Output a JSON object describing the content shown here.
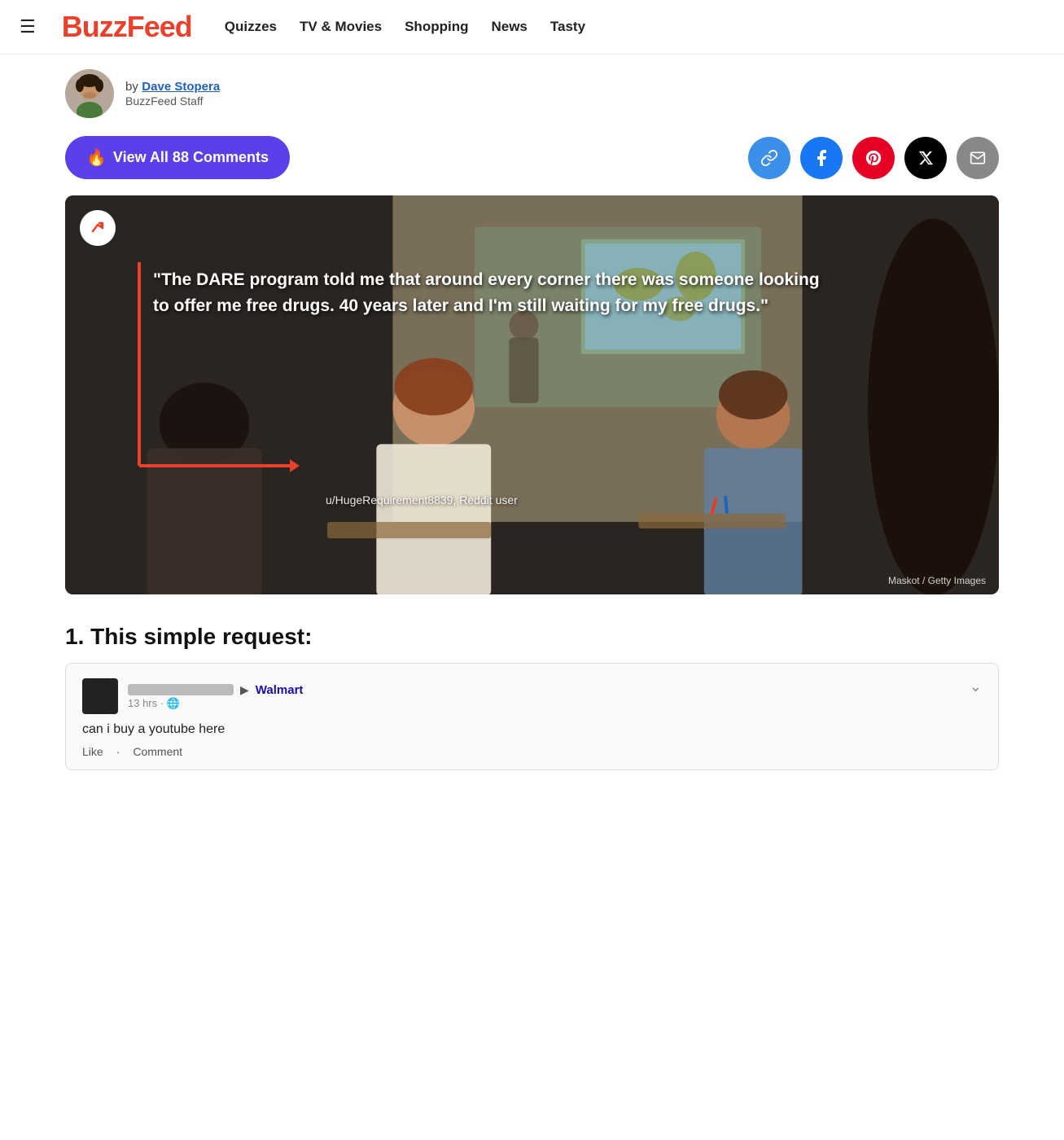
{
  "nav": {
    "hamburger_label": "☰",
    "logo": "BuzzFeed",
    "links": [
      {
        "id": "quizzes",
        "label": "Quizzes"
      },
      {
        "id": "tv-movies",
        "label": "TV & Movies"
      },
      {
        "id": "shopping",
        "label": "Shopping"
      },
      {
        "id": "news",
        "label": "News"
      },
      {
        "id": "tasty",
        "label": "Tasty"
      }
    ]
  },
  "author": {
    "by_label": "by",
    "name": "Dave Stopera",
    "staff_label": "BuzzFeed Staff"
  },
  "actions": {
    "comments_button": {
      "fire_emoji": "🔥",
      "label": "View All 88 Comments"
    },
    "share_icons": [
      {
        "id": "link",
        "label": "🔗",
        "title": "Copy link"
      },
      {
        "id": "facebook",
        "label": "f",
        "title": "Share on Facebook"
      },
      {
        "id": "pinterest",
        "label": "P",
        "title": "Share on Pinterest"
      },
      {
        "id": "x",
        "label": "𝕏",
        "title": "Share on X"
      },
      {
        "id": "mail",
        "label": "✉",
        "title": "Share via email"
      }
    ]
  },
  "hero_image": {
    "quote": "\"The DARE program told me that around every corner there was someone looking to offer me free drugs. 40 years later and I'm still waiting for my free drugs.\"",
    "attribution": "u/HugeRequirement8839, Reddit user",
    "credit": "Maskot / Getty Images"
  },
  "article": {
    "item_number": "1.",
    "item_title": "This simple request:",
    "comment": {
      "target": "Walmart",
      "time": "13 hrs · 🌐",
      "text": "can i buy a youtube here",
      "like_label": "Like",
      "comment_label": "Comment"
    }
  }
}
